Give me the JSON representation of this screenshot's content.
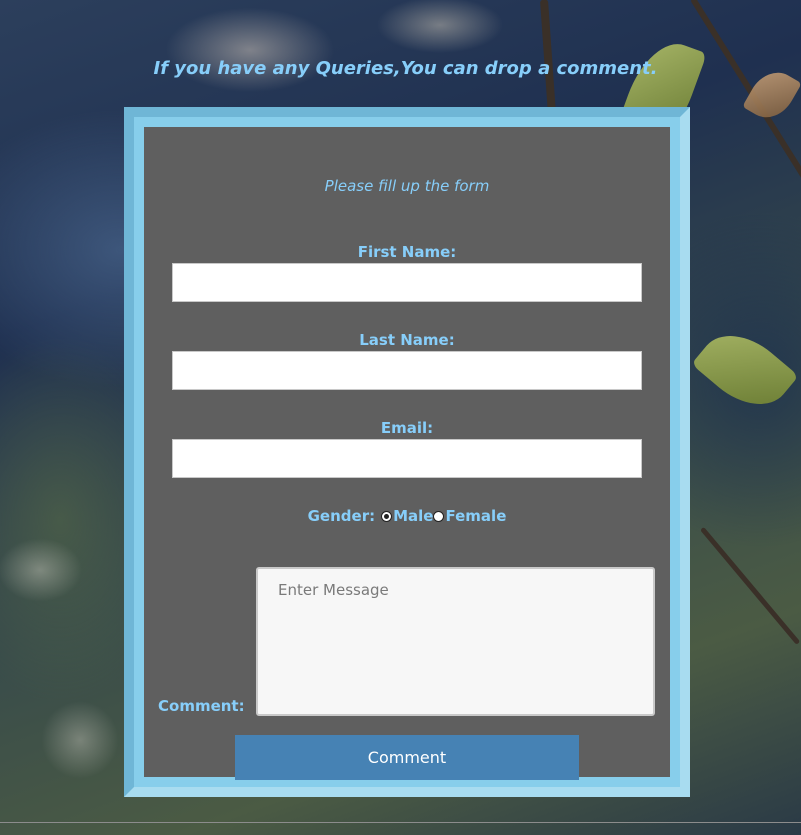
{
  "page": {
    "heading": "If you have any Queries,You can drop a comment."
  },
  "form": {
    "subtitle": "Please fill up the form",
    "first_name_label": "First Name:",
    "last_name_label": "Last Name:",
    "email_label": "Email:",
    "gender_label": "Gender:",
    "gender_options": [
      {
        "label": "Male",
        "selected": true
      },
      {
        "label": "Female",
        "selected": false
      }
    ],
    "comment_label": "Comment:",
    "message_placeholder": "Enter Message",
    "submit_label": "Comment"
  },
  "colors": {
    "accent": "#87cefa",
    "button": "#4682b4",
    "panel": "#5f5f5f",
    "frame": "#87ceeb"
  }
}
